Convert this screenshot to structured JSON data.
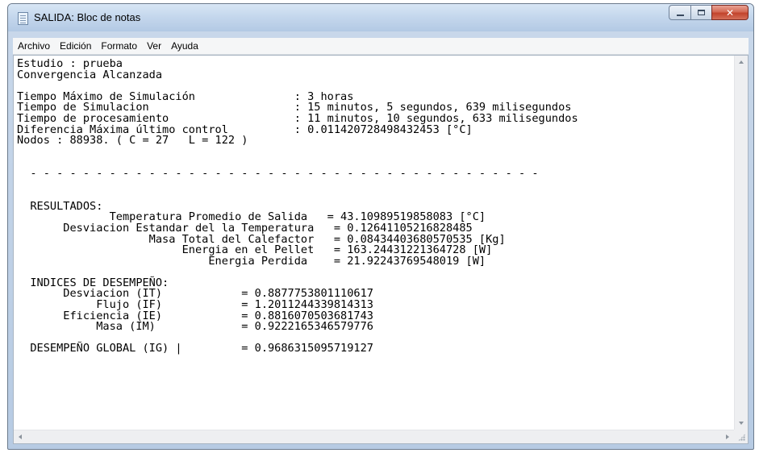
{
  "window": {
    "title": "SALIDA: Bloc de notas",
    "controls": {
      "minimize": "minimize",
      "maximize": "maximize",
      "close": "✕"
    }
  },
  "menu": [
    "Archivo",
    "Edición",
    "Formato",
    "Ver",
    "Ayuda"
  ],
  "content": {
    "lines": [
      "Estudio : prueba",
      "Convergencia Alcanzada",
      "",
      "Tiempo Máximo de Simulación               : 3 horas",
      "Tiempo de Simulacion                      : 15 minutos, 5 segundos, 639 milisegundos",
      "Tiempo de procesamiento                   : 11 minutos, 10 segundos, 633 milisegundos",
      "Diferencia Máxima último control          : 0.011420728498432453 [°C]",
      "Nodos : 88938. ( C = 27   L = 122 )",
      "",
      "",
      "  - - - - - - - - - - - - - - - - - - - - - - - - - - - - - - - - - - - - - - -",
      "",
      "",
      "  RESULTADOS:",
      "              Temperatura Promedio de Salida   = 43.10989519858083 [°C]",
      "       Desviacion Estandar del la Temperatura   = 0.12641105216828485",
      "                    Masa Total del Calefactor   = 0.08434403680570535 [Kg]",
      "                         Energia en el Pellet   = 163.24431221364728 [W]",
      "                             Energia Perdida    = 21.92243769548019 [W]",
      "",
      "  INDICES DE DESEMPEÑO:",
      "       Desviacion (IT)            = 0.8877753801110617",
      "            Flujo (IF)            = 1.2011244339814313",
      "       Eficiencia (IE)            = 0.8816070503681743",
      "            Masa (IM)             = 0.9222165346579776",
      "",
      "  DESEMPEÑO GLOBAL (IG) |         = 0.9686315095719127"
    ]
  }
}
